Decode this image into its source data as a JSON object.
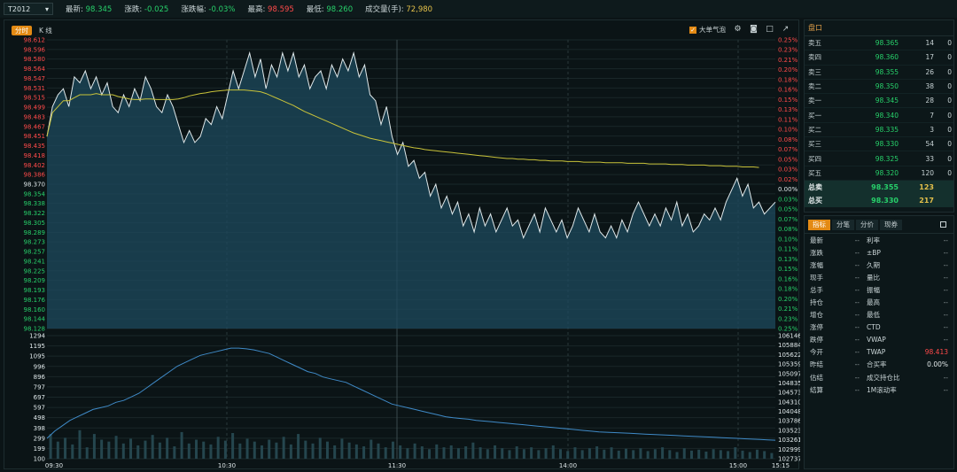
{
  "topbar": {
    "symbol": "T2012",
    "latest_label": "最新:",
    "latest": "98.345",
    "change_label": "涨跌:",
    "change": "-0.025",
    "change_pct_label": "涨跌幅:",
    "change_pct": "-0.03%",
    "high_label": "最高:",
    "high": "98.595",
    "low_label": "最低:",
    "low": "98.260",
    "volume_label": "成交量(手):",
    "volume": "72,980"
  },
  "chart_tabs": {
    "intraday": "分时",
    "kline": "K 线"
  },
  "chart_tools": {
    "big_order_label": "大单气泡"
  },
  "colors": {
    "accent": "#e38a14",
    "up": "#ff4a4a",
    "down": "#27d06a",
    "price_line": "#dfe8ea",
    "avg_line": "#c9c33a",
    "area_fill": "#1d4a5e",
    "volume_line": "#3f8ac7"
  },
  "chart_data": {
    "type": "line",
    "price_axis_left": [
      "98.612",
      "98.596",
      "98.580",
      "98.564",
      "98.547",
      "98.531",
      "98.515",
      "98.499",
      "98.483",
      "98.467",
      "98.451",
      "98.435",
      "98.418",
      "98.402",
      "98.386",
      "98.370",
      "98.354",
      "98.338",
      "98.322",
      "98.305",
      "98.289",
      "98.273",
      "98.257",
      "98.241",
      "98.225",
      "98.209",
      "98.193",
      "98.176",
      "98.160",
      "98.144",
      "98.128"
    ],
    "pct_axis_right": [
      "0.25%",
      "0.23%",
      "0.21%",
      "0.20%",
      "0.18%",
      "0.16%",
      "0.15%",
      "0.13%",
      "0.11%",
      "0.10%",
      "0.08%",
      "0.07%",
      "0.05%",
      "0.03%",
      "0.02%",
      "0.00%",
      "0.03%",
      "0.05%",
      "0.07%",
      "0.08%",
      "0.10%",
      "0.11%",
      "0.13%",
      "0.15%",
      "0.16%",
      "0.18%",
      "0.20%",
      "0.21%",
      "0.23%",
      "0.25%"
    ],
    "volume_axis_left": [
      "1294",
      "1195",
      "1095",
      "996",
      "896",
      "797",
      "697",
      "597",
      "498",
      "398",
      "299",
      "199",
      "100"
    ],
    "oi_axis_right": [
      "106146",
      "105884",
      "105622",
      "105359",
      "105097",
      "104835",
      "104573",
      "104310",
      "104048",
      "103786",
      "103523",
      "103261",
      "102999",
      "102737"
    ],
    "time_labels": [
      "09:30",
      "10:30",
      "11:30",
      "14:00",
      "15:00",
      "15:15"
    ],
    "price_range": [
      98.128,
      98.612
    ],
    "prev_close": 98.37,
    "price_series": [
      98.45,
      98.5,
      98.52,
      98.53,
      98.5,
      98.55,
      98.54,
      98.56,
      98.53,
      98.55,
      98.52,
      98.54,
      98.5,
      98.49,
      98.52,
      98.5,
      98.53,
      98.51,
      98.55,
      98.53,
      98.5,
      98.49,
      98.52,
      98.5,
      98.47,
      98.44,
      98.46,
      98.44,
      98.45,
      98.48,
      98.47,
      98.5,
      98.48,
      98.52,
      98.56,
      98.53,
      98.56,
      98.59,
      98.55,
      98.58,
      98.53,
      98.57,
      98.55,
      98.59,
      98.56,
      98.59,
      98.55,
      98.57,
      98.53,
      98.55,
      98.56,
      98.53,
      98.57,
      98.55,
      98.58,
      98.56,
      98.59,
      98.55,
      98.57,
      98.52,
      98.51,
      98.47,
      98.5,
      98.45,
      98.42,
      98.44,
      98.4,
      98.41,
      98.38,
      98.39,
      98.35,
      98.37,
      98.33,
      98.35,
      98.32,
      98.34,
      98.3,
      98.32,
      98.29,
      98.33,
      98.3,
      98.32,
      98.29,
      98.31,
      98.33,
      98.3,
      98.31,
      98.28,
      98.3,
      98.32,
      98.29,
      98.33,
      98.31,
      98.29,
      98.31,
      98.28,
      98.3,
      98.33,
      98.31,
      98.29,
      98.32,
      98.29,
      98.28,
      98.3,
      98.28,
      98.31,
      98.29,
      98.32,
      98.34,
      98.32,
      98.3,
      98.32,
      98.3,
      98.33,
      98.31,
      98.34,
      98.3,
      98.32,
      98.29,
      98.3,
      98.32,
      98.31,
      98.33,
      98.31,
      98.34,
      98.36,
      98.38,
      98.35,
      98.37,
      98.33,
      98.34,
      98.32,
      98.33,
      98.34
    ],
    "avg_series": [
      98.45,
      98.49,
      98.5,
      98.51,
      98.51,
      98.515,
      98.52,
      98.52,
      98.52,
      98.522,
      98.52,
      98.52,
      98.52,
      98.517,
      98.515,
      98.513,
      98.512,
      98.512,
      98.513,
      98.513,
      98.512,
      98.512,
      98.512,
      98.512,
      98.513,
      98.515,
      98.518,
      98.52,
      98.522,
      98.523,
      98.525,
      98.526,
      98.527,
      98.528,
      98.528,
      98.528,
      98.528,
      98.527,
      98.526,
      98.525,
      98.522,
      98.518,
      98.514,
      98.51,
      98.506,
      98.502,
      98.497,
      98.492,
      98.488,
      98.484,
      98.48,
      98.476,
      98.472,
      98.468,
      98.464,
      98.46,
      98.456,
      98.453,
      98.45,
      98.447,
      98.445,
      98.443,
      98.441,
      98.439,
      98.437,
      98.435,
      98.433,
      98.431,
      98.43,
      98.428,
      98.427,
      98.426,
      98.425,
      98.424,
      98.423,
      98.422,
      98.421,
      98.42,
      98.419,
      98.418,
      98.417,
      98.416,
      98.415,
      98.414,
      98.413,
      98.413,
      98.412,
      98.412,
      98.411,
      98.411,
      98.41,
      98.41,
      98.409,
      98.409,
      98.409,
      98.408,
      98.408,
      98.408,
      98.407,
      98.407,
      98.407,
      98.407,
      98.406,
      98.406,
      98.406,
      98.406,
      98.405,
      98.405,
      98.405,
      98.405,
      98.404,
      98.404,
      98.404,
      98.404,
      98.403,
      98.403,
      98.403,
      98.402,
      98.402,
      98.402,
      98.402,
      98.401,
      98.401,
      98.401,
      98.4,
      98.4,
      98.4,
      98.399,
      98.399,
      98.399,
      98.398
    ],
    "volume_range": [
      0,
      1294
    ],
    "oi_range": [
      102737,
      106146
    ],
    "oi_series": [
      103300,
      103500,
      103650,
      103800,
      103900,
      104000,
      104100,
      104150,
      104200,
      104300,
      104350,
      104450,
      104550,
      104700,
      104850,
      105000,
      105150,
      105300,
      105400,
      105500,
      105600,
      105650,
      105700,
      105750,
      105800,
      105800,
      105780,
      105750,
      105700,
      105650,
      105550,
      105450,
      105350,
      105250,
      105150,
      105100,
      105000,
      104950,
      104900,
      104850,
      104750,
      104650,
      104550,
      104450,
      104350,
      104250,
      104200,
      104150,
      104100,
      104050,
      104000,
      103950,
      103900,
      103870,
      103850,
      103830,
      103800,
      103780,
      103760,
      103740,
      103720,
      103700,
      103680,
      103660,
      103640,
      103620,
      103600,
      103580,
      103560,
      103540,
      103520,
      103500,
      103480,
      103470,
      103460,
      103450,
      103440,
      103430,
      103420,
      103410,
      103400,
      103390,
      103380,
      103370,
      103360,
      103350,
      103340,
      103330,
      103320,
      103310,
      103300,
      103290,
      103280,
      103270,
      103260,
      103250
    ],
    "volume_series": [
      260,
      180,
      220,
      150,
      300,
      120,
      260,
      200,
      180,
      240,
      160,
      210,
      140,
      190,
      250,
      170,
      220,
      130,
      280,
      160,
      200,
      180,
      150,
      230,
      190,
      270,
      160,
      210,
      180,
      140,
      200,
      170,
      230,
      150,
      260,
      190,
      160,
      220,
      180,
      140,
      210,
      170,
      150,
      130,
      200,
      160,
      120,
      180,
      140,
      110,
      160,
      130,
      100,
      150,
      120,
      140,
      110,
      130,
      170,
      120,
      100,
      140,
      110,
      90,
      130,
      100,
      120,
      90,
      110,
      140,
      100,
      80,
      120,
      90,
      110,
      130,
      95,
      120,
      85,
      105,
      90,
      110,
      80,
      100,
      120,
      90,
      70,
      110,
      85,
      95,
      75,
      100,
      90,
      80,
      120,
      85,
      70,
      95,
      80,
      60
    ]
  },
  "book": {
    "title": "盘口",
    "asks": [
      {
        "label": "卖五",
        "price": "98.365",
        "vol": "14",
        "chg": "0"
      },
      {
        "label": "卖四",
        "price": "98.360",
        "vol": "17",
        "chg": "0"
      },
      {
        "label": "卖三",
        "price": "98.355",
        "vol": "26",
        "chg": "0"
      },
      {
        "label": "卖二",
        "price": "98.350",
        "vol": "38",
        "chg": "0"
      },
      {
        "label": "卖一",
        "price": "98.345",
        "vol": "28",
        "chg": "0"
      }
    ],
    "bids": [
      {
        "label": "买一",
        "price": "98.340",
        "vol": "7",
        "chg": "0"
      },
      {
        "label": "买二",
        "price": "98.335",
        "vol": "3",
        "chg": "0"
      },
      {
        "label": "买三",
        "price": "98.330",
        "vol": "54",
        "chg": "0"
      },
      {
        "label": "买四",
        "price": "98.325",
        "vol": "33",
        "chg": "0"
      },
      {
        "label": "买五",
        "price": "98.320",
        "vol": "120",
        "chg": "0"
      }
    ],
    "total_sell": {
      "label": "总卖",
      "price": "98.355",
      "vol": "123"
    },
    "total_buy": {
      "label": "总买",
      "price": "98.330",
      "vol": "217"
    }
  },
  "info": {
    "tabs": [
      "指标",
      "分笔",
      "分价",
      "现券"
    ],
    "rows": [
      {
        "l": "最新",
        "v": "--",
        "l2": "利率",
        "v2": "--",
        "v2_color": ""
      },
      {
        "l": "涨跌",
        "v": "--",
        "l2": "±BP",
        "v2": "--",
        "v2_color": ""
      },
      {
        "l": "涨幅",
        "v": "--",
        "l2": "久期",
        "v2": "--",
        "v2_color": ""
      },
      {
        "l": "现手",
        "v": "--",
        "l2": "量比",
        "v2": "--",
        "v2_color": ""
      },
      {
        "l": "总手",
        "v": "--",
        "l2": "振幅",
        "v2": "--",
        "v2_color": ""
      },
      {
        "l": "持仓",
        "v": "--",
        "l2": "最高",
        "v2": "--",
        "v2_color": ""
      },
      {
        "l": "增仓",
        "v": "--",
        "l2": "最低",
        "v2": "--",
        "v2_color": ""
      },
      {
        "l": "涨停",
        "v": "--",
        "l2": "CTD",
        "v2": "--",
        "v2_color": ""
      },
      {
        "l": "跌停",
        "v": "--",
        "l2": "VWAP",
        "v2": "--",
        "v2_color": ""
      },
      {
        "l": "今开",
        "v": "--",
        "l2": "TWAP",
        "v2": "98.413",
        "v2_color": "#ff4a4a"
      },
      {
        "l": "昨结",
        "v": "--",
        "l2": "合买率",
        "v2": "0.00%",
        "v2_color": "#e2e9ea"
      },
      {
        "l": "估结",
        "v": "--",
        "l2": "成交持仓比",
        "v2": "--",
        "v2_color": ""
      },
      {
        "l": "结算",
        "v": "--",
        "l2": "1M滚动率",
        "v2": "--",
        "v2_color": ""
      }
    ]
  }
}
